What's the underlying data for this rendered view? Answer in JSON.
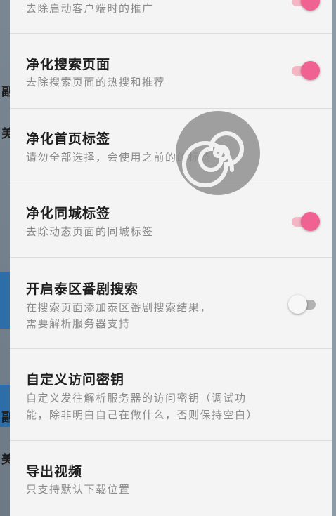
{
  "background": {
    "side_chars": [
      "副",
      "美",
      "副",
      "美"
    ]
  },
  "settings": [
    {
      "title": "",
      "summary_lines": [
        "去除启动客户端时的推广"
      ],
      "toggle": "on"
    },
    {
      "title": "净化搜索页面",
      "summary_lines": [
        "去除搜索页面的热搜和推荐"
      ],
      "toggle": "on"
    },
    {
      "title": "净化首页标签",
      "summary_lines": [
        "请勿全部选择，会使用之前的的标签"
      ],
      "toggle": null
    },
    {
      "title": "净化同城标签",
      "summary_lines": [
        "去除动态页面的同城标签"
      ],
      "toggle": "on"
    },
    {
      "title": "开启泰区番剧搜索",
      "summary_lines": [
        "在搜索页面添加泰区番剧搜索结果，",
        "需要解析服务器支持"
      ],
      "toggle": "off"
    },
    {
      "title": "自定义访问密钥",
      "summary_lines": [
        "自定义发往解析服务器的访问密钥（调试功",
        "能，除非明白自己在做什么，否则保持空白）"
      ],
      "toggle": null
    },
    {
      "title": "导出视频",
      "summary_lines": [
        "只支持默认下载位置"
      ],
      "toggle": null
    }
  ],
  "colors": {
    "accent": "#f06292",
    "accent_track": "#f4b5c4",
    "sheet_bg": "#f4f4f4",
    "title": "#1e1e1e",
    "summary": "#8a8a8a"
  },
  "icons": {
    "loading": "spiral-loading-icon"
  }
}
